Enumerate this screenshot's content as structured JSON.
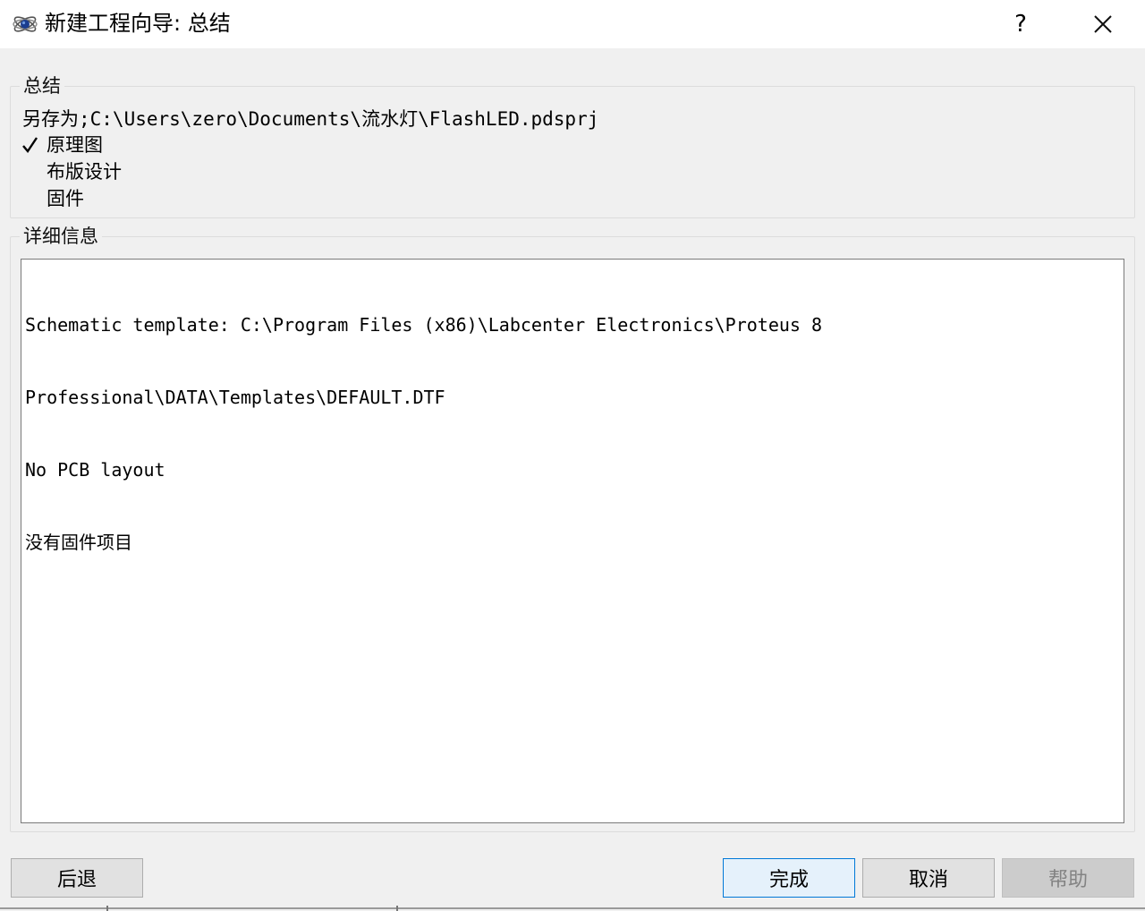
{
  "window": {
    "title": "新建工程向导: 总结",
    "help_label": "?",
    "icon": "proteus-atom-icon",
    "close_icon": "close-icon"
  },
  "summary": {
    "legend": "总结",
    "save_as": "另存为;C:\\Users\\zero\\Documents\\流水灯\\FlashLED.pdsprj",
    "items": [
      {
        "label": "原理图",
        "checked": true
      },
      {
        "label": "布版设计",
        "checked": false
      },
      {
        "label": "固件",
        "checked": false
      }
    ]
  },
  "details": {
    "legend": "详细信息",
    "lines": [
      "Schematic template: C:\\Program Files (x86)\\Labcenter Electronics\\Proteus 8",
      "Professional\\DATA\\Templates\\DEFAULT.DTF",
      "No PCB layout",
      "没有固件项目"
    ]
  },
  "buttons": {
    "back": "后退",
    "finish": "完成",
    "cancel": "取消",
    "help": "帮助"
  },
  "colors": {
    "finish_border": "#0078d7",
    "finish_background": "#e5f1fb",
    "dialog_background": "#f0f0f0"
  }
}
